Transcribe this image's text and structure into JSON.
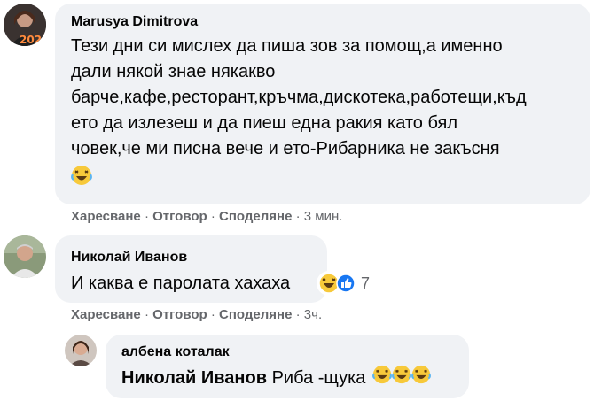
{
  "comments": [
    {
      "author": "Marusya Dimitrova",
      "avatar_badge": "2020",
      "lines": [
        "Тези дни си мислех да пиша зов за помощ,а именно",
        "дали някой знае някакво",
        "барче,кафе,ресторант,кръчма,дискотека,работещи,къд",
        "ето да излезеш и да пиеш една ракия като бял",
        "човек,че ми писна вече и ето-Рибарника не закъсня"
      ],
      "end_emoji": "laughing-tears-emoji",
      "actions": {
        "like": "Харесване",
        "reply": "Отговор",
        "share": "Споделяне",
        "separator": "·",
        "time": "3 мин."
      }
    },
    {
      "author": "Николай Иванов",
      "text": "И каква е паролата хахаха",
      "reactions": {
        "icons": [
          "haha-reaction-icon",
          "like-reaction-icon"
        ],
        "count": "7"
      },
      "actions": {
        "like": "Харесване",
        "reply": "Отговор",
        "share": "Споделяне",
        "separator": "·",
        "time": "3ч."
      }
    },
    {
      "author": "албена коталак",
      "mention": "Николай Иванов",
      "text": " Риба -щука",
      "end_emojis": [
        "laughing-tears-emoji",
        "laughing-tears-emoji",
        "laughing-tears-emoji"
      ]
    }
  ],
  "colors": {
    "bubble": "#f0f2f5",
    "text": "#050505",
    "meta": "#65676b",
    "like_blue": "#1877f2",
    "emoji_yellow": "#f7c93a"
  }
}
